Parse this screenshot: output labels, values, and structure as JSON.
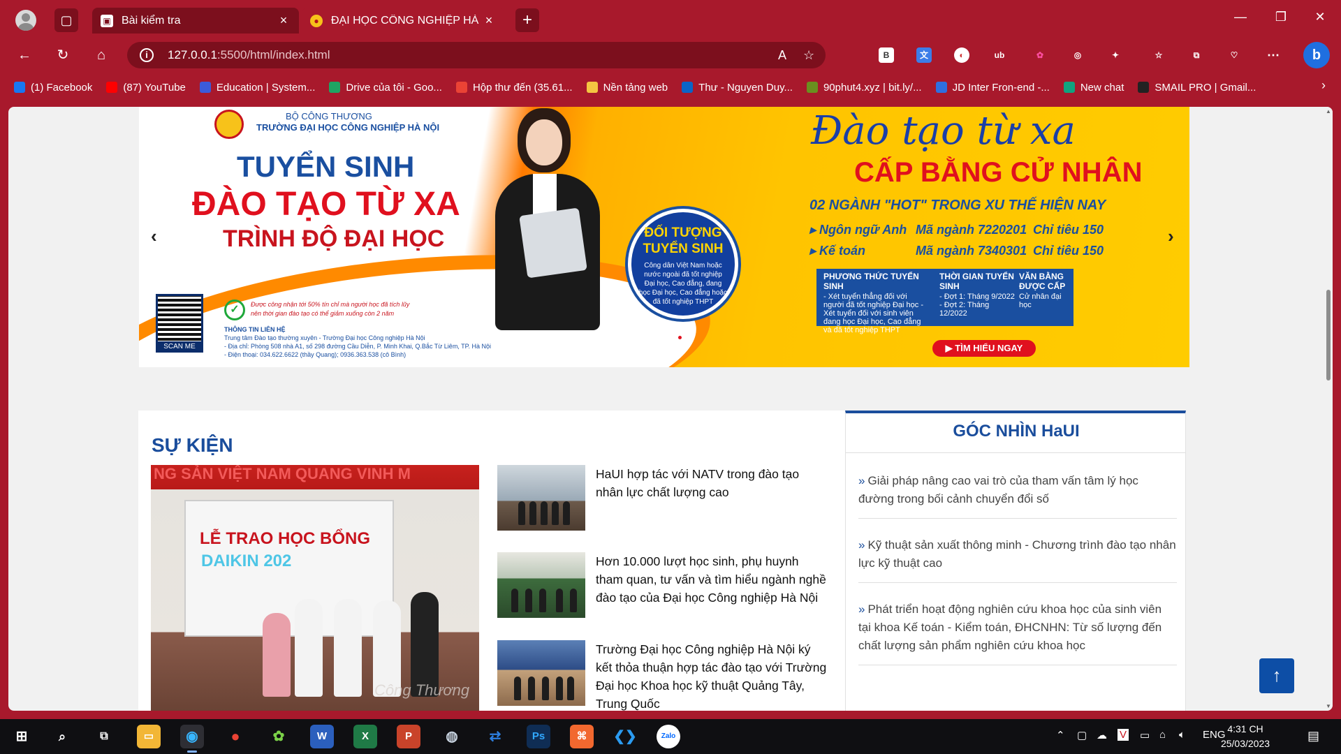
{
  "browser": {
    "tabs": [
      {
        "label": "Bài kiểm tra",
        "icon": "user-card-icon",
        "active": true
      },
      {
        "label": "ĐẠI HỌC CÔNG NGHIỆP HÀ NỘI",
        "icon": "haui-logo-icon",
        "active": false
      }
    ],
    "url_host": "127.0.0.1",
    "url_rest": ":5500/html/index.html",
    "bookmarks": [
      {
        "label": "(1) Facebook",
        "icon": "facebook-icon",
        "color": "#1877f2"
      },
      {
        "label": "(87) YouTube",
        "icon": "youtube-icon",
        "color": "#ff0000"
      },
      {
        "label": "Education | System...",
        "icon": "education-icon",
        "color": "#3b5bdb"
      },
      {
        "label": "Drive của tôi - Goo...",
        "icon": "google-drive-icon",
        "color": "#1fa463"
      },
      {
        "label": "Hộp thư đến (35.61...",
        "icon": "gmail-icon",
        "color": "#ea4335"
      },
      {
        "label": "Nền tảng web",
        "icon": "folder-icon",
        "color": "#f4c542"
      },
      {
        "label": "Thư - Nguyen Duy...",
        "icon": "outlook-icon",
        "color": "#0a64c8"
      },
      {
        "label": "90phut4.xyz | bit.ly/...",
        "icon": "football-icon",
        "color": "#6a8f1f"
      },
      {
        "label": "JD Inter Fron-end -...",
        "icon": "doc-icon",
        "color": "#2f6fe0"
      },
      {
        "label": "New chat",
        "icon": "chatgpt-icon",
        "color": "#10a37f"
      },
      {
        "label": "SMAIL PRO | Gmail...",
        "icon": "smail-icon",
        "color": "#222222"
      }
    ]
  },
  "banner": {
    "ministry": "BỘ CÔNG THƯƠNG",
    "school": "TRƯỜNG ĐẠI HỌC CÔNG NGHIỆP HÀ NỘI",
    "title1": "TUYỂN SINH",
    "title2": "ĐÀO TẠO TỪ XA",
    "title3": "TRÌNH ĐỘ ĐẠI HỌC",
    "credit_note1": "Được công nhận tới 50% tín chỉ mà người học đã tích lũy",
    "credit_note2": "nên thời gian đào tạo có thể giảm xuống còn 2 năm",
    "contact_title": "THÔNG TIN LIÊN HỆ",
    "contact1": "Trung tâm Đào tạo thường xuyên - Trường Đại học Công nghiệp Hà Nội",
    "contact2": "- Địa chỉ: Phòng 508 nhà A1, số 298 đường Cầu Diễn, P. Minh Khai, Q.Bắc Từ Liêm, TP. Hà Nội",
    "contact3": "- Điện thoại: 034.622.6622 (thầy Quang); 0936.363.538 (cô Bình)",
    "scan": "SCAN ME",
    "target_title": "ĐỐI TƯỢNG TUYỂN SINH",
    "target_text": "Công dân Việt Nam hoặc nước ngoài đã tốt nghiệp Đại học, Cao đẳng, đang học Đại học, Cao đẳng hoặc đã tốt nghiệp THPT",
    "script_title": "Đào tạo từ xa",
    "cap": "CẤP BẰNG CỬ NHÂN",
    "hot": "02 NGÀNH \"HOT\" TRONG XU THẾ HIỆN NAY",
    "rows": [
      {
        "name": "Ngôn ngữ Anh",
        "code": "Mã ngành 7220201",
        "quota": "Chỉ tiêu 150"
      },
      {
        "name": "Kế toán",
        "code": "Mã ngành 7340301",
        "quota": "Chỉ tiêu 150"
      }
    ],
    "box": {
      "method_title": "PHƯƠNG THỨC TUYỂN SINH",
      "method_text": "- Xét tuyển thẳng đối với người đã tốt nghiệp Đại học - Xét tuyển đối với sinh viên đang học Đại học, Cao đẳng và đã tốt nghiệp THPT",
      "time_title": "THỜI GIAN TUYỂN SINH",
      "time_text": "- Đợt 1: Tháng 9/2022 - Đợt 2: Tháng 12/2022",
      "degree_title": "VĂN BẰNG ĐƯỢC CẤP",
      "degree_text": "Cử nhân đại học"
    },
    "button": "TÌM HIỂU NGAY",
    "prev": "‹",
    "next": "›"
  },
  "events": {
    "heading": "SỰ KIỆN",
    "photo_backdrop": "NG SẢN VIỆT NAM QUANG VINH M",
    "photo_title1": "LỄ TRAO HỌC BỔNG",
    "photo_title2": "DAIKIN 202",
    "photo_watermark": "Công Thương",
    "items": [
      "HaUI hợp tác với NATV trong đào tạo nhân lực chất lượng cao",
      "Hơn 10.000 lượt học sinh, phụ huynh tham quan, tư vấn và tìm hiểu ngành nghề đào tạo của Đại học Công nghiệp Hà Nội",
      "Trường Đại học Công nghiệp Hà Nội ký kết thỏa thuận hợp tác đào tạo với Trường Đại học Khoa học kỹ thuật Quảng Tây, Trung Quốc"
    ]
  },
  "goc": {
    "heading": "GÓC NHÌN HaUI",
    "chevron": "»",
    "items": [
      "Giải pháp nâng cao vai trò của tham vấn tâm lý học đường trong bối cảnh chuyển đổi số",
      "Kỹ thuật sản xuất thông minh - Chương trình đào tạo nhân lực kỹ thuật cao",
      "Phát triển hoạt động nghiên cứu khoa học của sinh viên tại khoa Kế toán - Kiểm toán, ĐHCNHN: Từ số lượng đến chất lượng sản phẩm nghiên cứu khoa học"
    ]
  },
  "back_to_top": "↑",
  "taskbar": {
    "lang": "ENG",
    "time": "4:31 CH",
    "date": "25/03/2023"
  }
}
